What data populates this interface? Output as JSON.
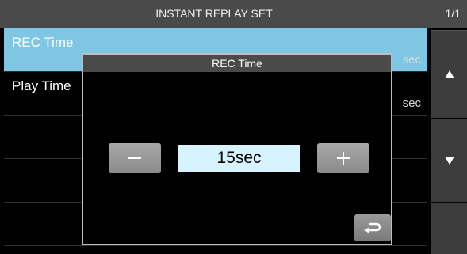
{
  "header": {
    "title": "INSTANT REPLAY SET",
    "page": "1/1"
  },
  "rows": [
    {
      "label": "REC Time",
      "value": "sec"
    },
    {
      "label": "Play Time",
      "value": "sec"
    }
  ],
  "side_buttons": {
    "up_icon": "triangle-up-icon",
    "down_icon": "triangle-down-icon"
  },
  "dialog": {
    "title": "REC Time",
    "value": "15sec",
    "minus_icon": "minus-icon",
    "plus_icon": "plus-icon",
    "back_icon": "return-arrow-icon"
  },
  "colors": {
    "selected_row": "#7fc6e4",
    "value_box": "#d7f3fd",
    "header": "#4a4a4a"
  }
}
